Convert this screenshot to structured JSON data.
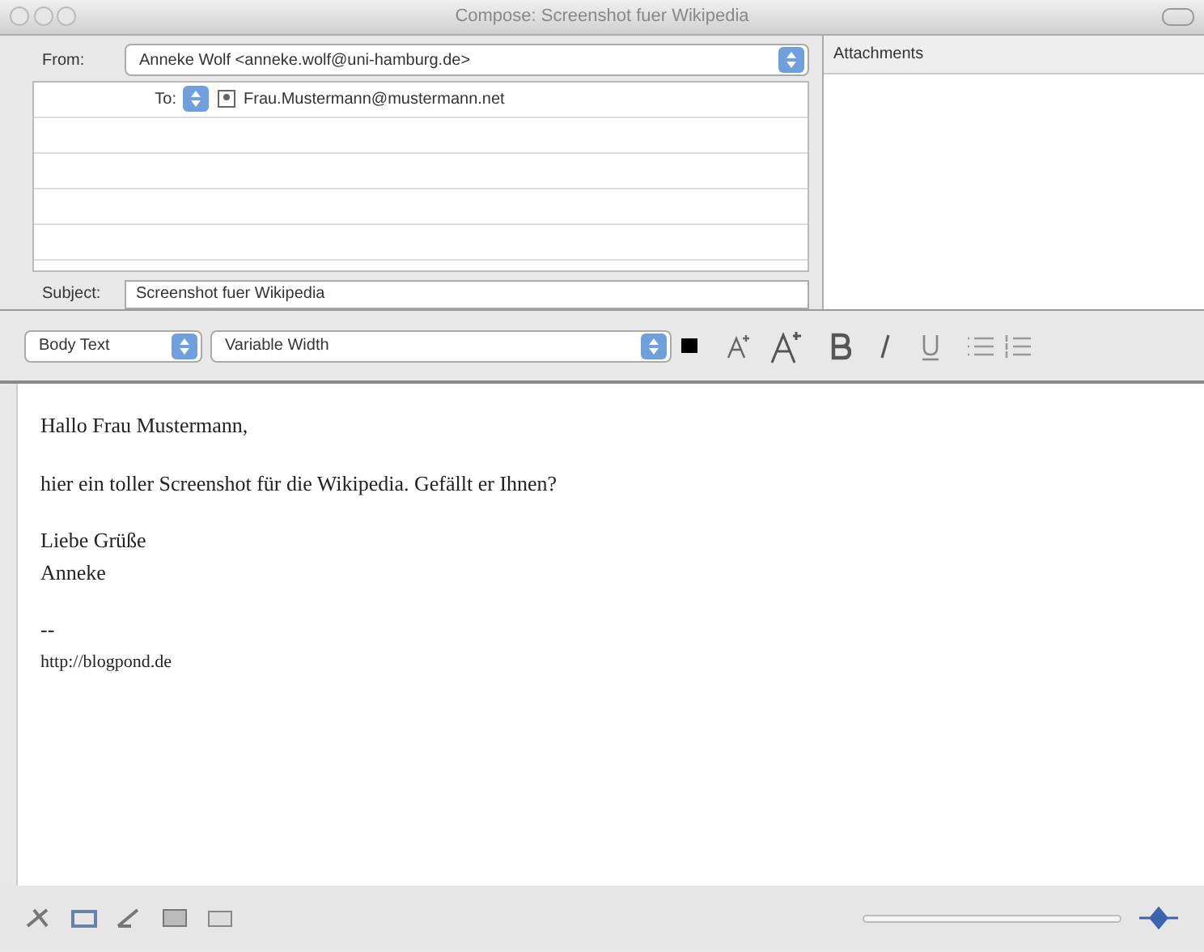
{
  "window": {
    "title": "Compose: Screenshot fuer Wikipedia"
  },
  "header": {
    "from": {
      "label": "From:",
      "value": "Anneke Wolf <anneke.wolf@uni-hamburg.de>"
    },
    "recipients": [
      {
        "type": "To:",
        "address": "Frau.Mustermann@mustermann.net"
      }
    ],
    "subject": {
      "label": "Subject:",
      "value": "Screenshot fuer Wikipedia"
    }
  },
  "attachments": {
    "label": "Attachments"
  },
  "format_toolbar": {
    "style": "Body Text",
    "font": "Variable Width"
  },
  "body": {
    "lines": [
      {
        "kind": "para",
        "text": "Hallo Frau Mustermann,"
      },
      {
        "kind": "para",
        "text": "hier ein toller Screenshot für die Wikipedia. Gefällt er Ihnen?"
      },
      {
        "kind": "para",
        "text": "Liebe Grüße"
      },
      {
        "kind": "line",
        "text": "Anneke"
      },
      {
        "kind": "para",
        "text": "--"
      },
      {
        "kind": "small",
        "text": "http://blogpond.de"
      }
    ]
  }
}
